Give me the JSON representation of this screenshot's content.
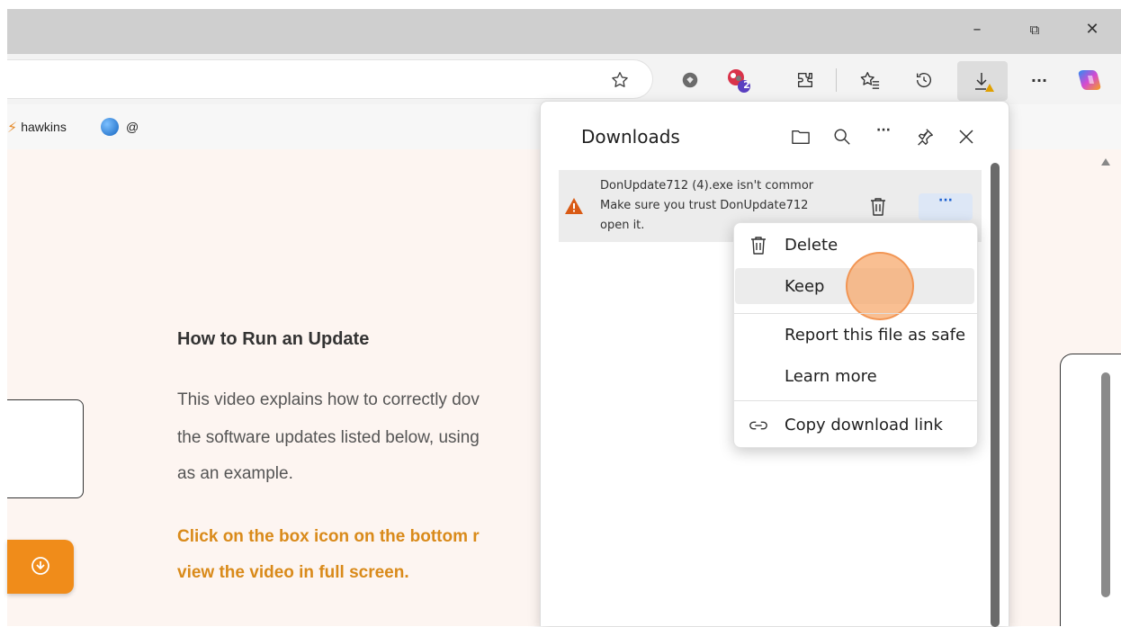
{
  "window": {
    "minimize_glyph": "–",
    "restore_glyph": "⧉",
    "close_glyph": "✕"
  },
  "toolbar": {
    "extension_badge": "2",
    "more_glyph": "···",
    "icons": [
      "favorite-star-icon",
      "shield-extension-icon",
      "profile-extension-icon",
      "extensions-icon",
      "favorites-icon",
      "history-icon",
      "downloads-warning-icon",
      "more-icon",
      "copilot-icon"
    ]
  },
  "favorites": {
    "item1": "hawkins",
    "item2": "@"
  },
  "page": {
    "heading": "How to Run an Update",
    "para_line1": "This video explains how to correctly dov",
    "para_line2": "the software updates listed below, using",
    "para_line3": "as an example.",
    "orange_line1": "Click on the box icon on the bottom r",
    "orange_line2": "view the video in full screen.",
    "colors": {
      "orange": "#e8890c",
      "bg": "#fdf5f1"
    }
  },
  "downloads": {
    "title": "Downloads",
    "item_line1": "DonUpdate712 (4).exe isn't commor",
    "item_line2": "Make sure you trust DonUpdate712",
    "item_line3": "open it.",
    "item_more": "···",
    "header_more": "···"
  },
  "menu": {
    "delete": "Delete",
    "keep": "Keep",
    "report": "Report this file as safe",
    "learn": "Learn more",
    "copy": "Copy download link"
  }
}
